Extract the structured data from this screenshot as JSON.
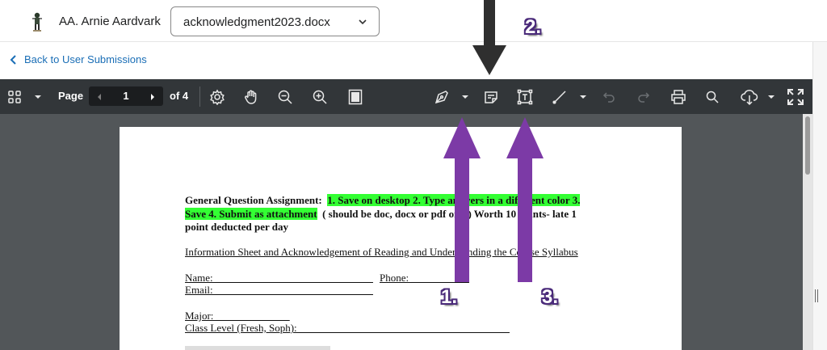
{
  "header": {
    "user_name": "AA. Arnie Aardvark",
    "file_select_value": "acknowledgment2023.docx"
  },
  "nav": {
    "back_label": "Back to User Submissions"
  },
  "toolbar": {
    "page_label": "Page",
    "current_page": "1",
    "of_label": "of 4",
    "icons": [
      "thumbnails-icon",
      "caret-down-icon",
      "previous-page-icon",
      "next-page-icon",
      "settings-icon",
      "pan-hand-icon",
      "zoom-out-icon",
      "zoom-in-icon",
      "fit-page-icon",
      "pen-icon",
      "caret-down-icon",
      "note-icon",
      "text-box-icon",
      "line-icon",
      "caret-down-icon",
      "undo-icon",
      "redo-icon",
      "print-icon",
      "search-icon",
      "download-icon",
      "caret-down-icon",
      "fullscreen-icon"
    ]
  },
  "document": {
    "line1_prefix": "General Question Assignment:",
    "line1_highlight": "1. Save on desktop 2. Type answers in a different color 3.",
    "line2_highlight": "Save 4. Submit as attachment",
    "line2_rest": "( should be doc, docx or pdf only) Worth 10 points- late 1",
    "line3": "point deducted per day",
    "line4": "Information Sheet and Acknowledgement of Reading and Understanding the Course Syllabus",
    "line5_name": "Name: ______________________________",
    "line5_phone": "Phone: ___________",
    "line6": "Email: ______________________________",
    "line7": "Major: ______________",
    "line8": "Class Level (Fresh, Soph): ________________________________________"
  },
  "annotations": {
    "label_1": "1.",
    "label_2": "2.",
    "label_3": "3.",
    "arrow_color": "#7c3aa6"
  }
}
